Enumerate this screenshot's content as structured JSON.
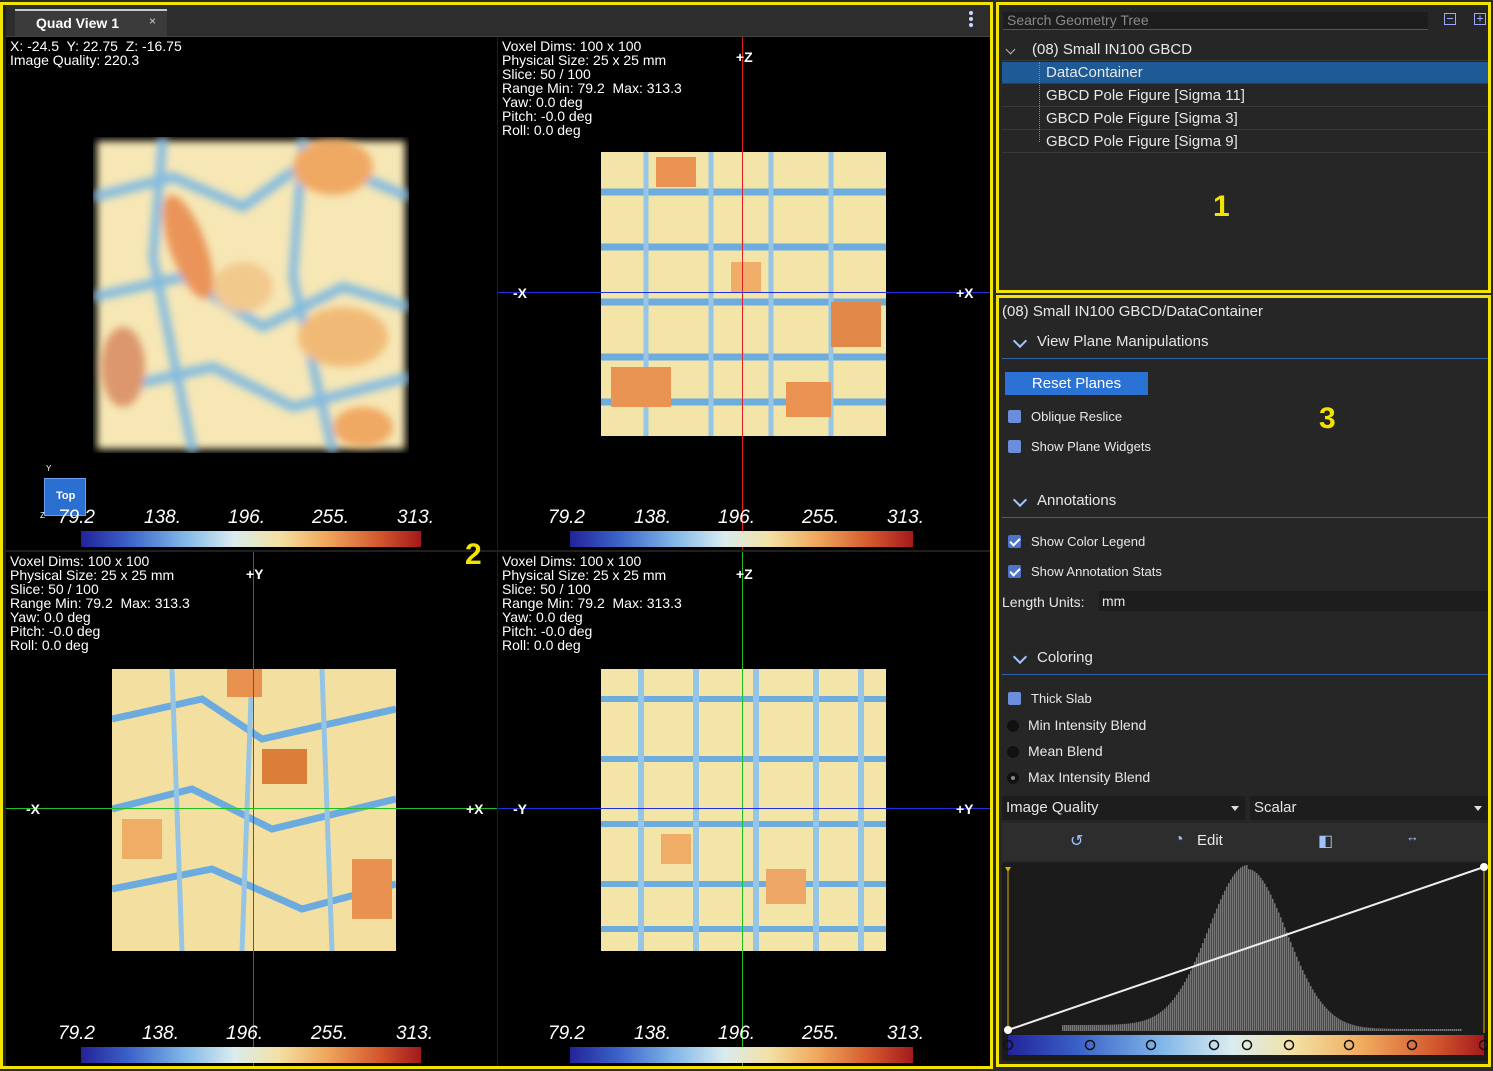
{
  "tab": {
    "title": "Quad View 1",
    "close": "×"
  },
  "viewports": {
    "v3d": {
      "info": "X: -24.5  Y: 22.75  Z: -16.75\nImage Quality: 220.3",
      "orient_label": "Top",
      "orient_y": "Y",
      "orient_z": "Z"
    },
    "tr": {
      "info": "Voxel Dims: 100 x 100\nPhysical Size: 25 x 25 mm\nSlice: 50 / 100\nRange Min: 79.2  Max: 313.3\nYaw: 0.0 deg\nPitch: -0.0 deg\nRoll: 0.0 deg",
      "top": "+Z",
      "left": "-X",
      "right": "+X"
    },
    "bl": {
      "info": "Voxel Dims: 100 x 100\nPhysical Size: 25 x 25 mm\nSlice: 50 / 100\nRange Min: 79.2  Max: 313.3\nYaw: 0.0 deg\nPitch: -0.0 deg\nRoll: 0.0 deg",
      "top": "+Y",
      "left": "-X",
      "right": "+X"
    },
    "br": {
      "info": "Voxel Dims: 100 x 100\nPhysical Size: 25 x 25 mm\nSlice: 50 / 100\nRange Min: 79.2  Max: 313.3\nYaw: 0.0 deg\nPitch: -0.0 deg\nRoll: 0.0 deg",
      "top": "+Z",
      "left": "-Y",
      "right": "+Y"
    }
  },
  "colorbar_ticks": [
    "79.2",
    "138.",
    "196.",
    "255.",
    "313."
  ],
  "annotation_numbers": {
    "one": "1",
    "two": "2",
    "three": "3"
  },
  "tree": {
    "search_placeholder": "Search Geometry Tree",
    "root": "(08) Small IN100 GBCD",
    "children": [
      "DataContainer",
      "GBCD Pole Figure [Sigma 11]",
      "GBCD Pole Figure [Sigma 3]",
      "GBCD Pole Figure [Sigma 9]"
    ],
    "selected_index": 0
  },
  "props": {
    "path": "(08) Small IN100 GBCD/DataContainer",
    "view_plane": {
      "title": "View Plane Manipulations",
      "reset": "Reset Planes",
      "oblique": "Oblique Reslice",
      "plane_widgets": "Show Plane Widgets"
    },
    "annotations": {
      "title": "Annotations",
      "color_legend": "Show Color Legend",
      "stats": "Show Annotation Stats",
      "units_label": "Length Units:",
      "units_value": "mm"
    },
    "coloring": {
      "title": "Coloring",
      "thick_slab": "Thick Slab",
      "blend_min": "Min Intensity Blend",
      "blend_mean": "Mean Blend",
      "blend_max": "Max Intensity Blend",
      "array": "Image Quality",
      "component": "Scalar",
      "edit": "Edit"
    }
  },
  "colors": {
    "highlight": "#f2e400",
    "selection": "#1e5a95",
    "button": "#2a73d4"
  }
}
